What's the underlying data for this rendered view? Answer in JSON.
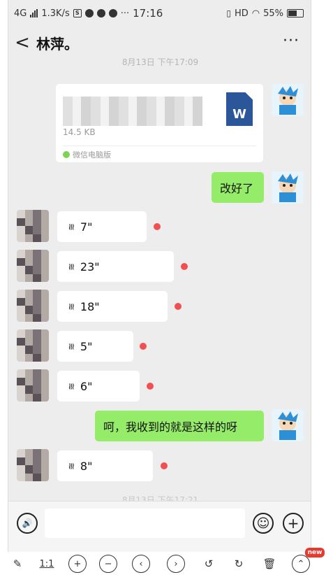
{
  "status_bar": {
    "network": "4G",
    "speed": "1.3K/s",
    "time": "17:16",
    "hd": "HD",
    "battery": "55%",
    "dots": "···"
  },
  "header": {
    "back": "<",
    "title": "林萍。",
    "more": "···"
  },
  "timestamps": {
    "top": "8月13日 下午17:09",
    "bottom": "8月13日 下午17:21"
  },
  "file_message": {
    "size": "14.5 KB",
    "source": "微信电脑版",
    "type_letter": "W"
  },
  "messages": {
    "reply1": "改好了",
    "voice1": "7\"",
    "voice2": "23\"",
    "voice3": "18\"",
    "voice4": "5\"",
    "voice5": "6\"",
    "reply2": "呵，我收到的就是这样的呀",
    "voice6": "8\""
  },
  "input_bar": {
    "voice_icon": "🔊",
    "emoji_icon": "☺",
    "plus_icon": "+"
  },
  "toolbar": {
    "ratio": "1:1",
    "badge": "new"
  },
  "colors": {
    "chat_bg": "#ededed",
    "my_bubble": "#95ec69",
    "unread_dot": "#f25050",
    "word_blue": "#2b579a"
  }
}
